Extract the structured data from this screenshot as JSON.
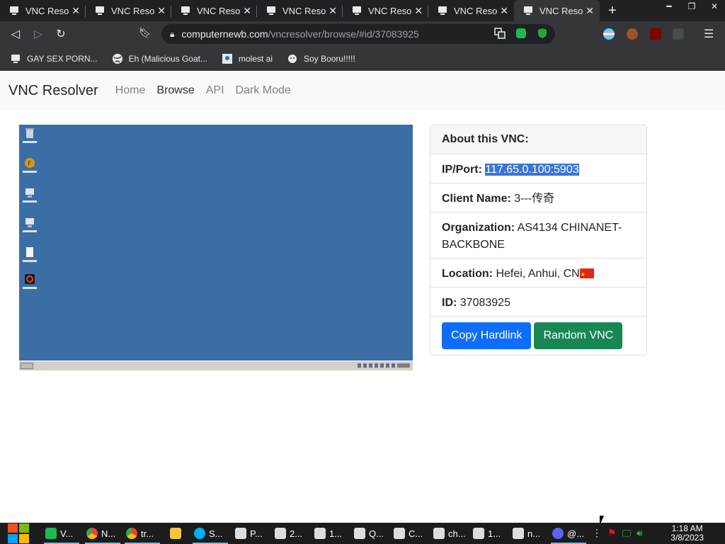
{
  "browser": {
    "tabs": [
      {
        "title": "VNC Resolv"
      },
      {
        "title": "VNC Resolv"
      },
      {
        "title": "VNC Resolv"
      },
      {
        "title": "VNC Resolv"
      },
      {
        "title": "VNC Resolv"
      },
      {
        "title": "VNC Resolv"
      },
      {
        "title": "VNC Resolv"
      }
    ],
    "address_domain": "computernewb.com",
    "address_rest": "/vncresolver/browse/#id/37083925",
    "bookmarks": [
      {
        "label": "GAY SEX PORN..."
      },
      {
        "label": "Eh (Malicious Goat..."
      },
      {
        "label": "molest ai"
      },
      {
        "label": "Soy Booru!!!!!"
      }
    ]
  },
  "site": {
    "brand": "VNC Resolver",
    "nav": [
      "Home",
      "Browse",
      "API",
      "Dark Mode"
    ],
    "active_nav": "Browse"
  },
  "card": {
    "header": "About this VNC:",
    "ip_label": "IP/Port:",
    "ip_value": "117.65.0.100:5903",
    "client_label": "Client Name:",
    "client_value": "3---传奇",
    "org_label": "Organization:",
    "org_value": "AS4134 CHINANET-BACKBONE",
    "loc_label": "Location:",
    "loc_value": "Hefei, Anhui, CN",
    "id_label": "ID:",
    "id_value": "37083925",
    "copy_button": "Copy Hardlink",
    "random_button": "Random VNC"
  },
  "taskbar": {
    "items": [
      "V...",
      "N...",
      "tr...",
      "",
      "S...",
      "P...",
      "2...",
      "1...",
      "Q...",
      "C...",
      "ch...",
      "1...",
      "n...",
      "@..."
    ],
    "time": "1:18 AM",
    "date": "3/8/2023"
  },
  "colors": {
    "primary": "#0d6efd",
    "success": "#198754",
    "desktop": "#3a6ea5"
  }
}
